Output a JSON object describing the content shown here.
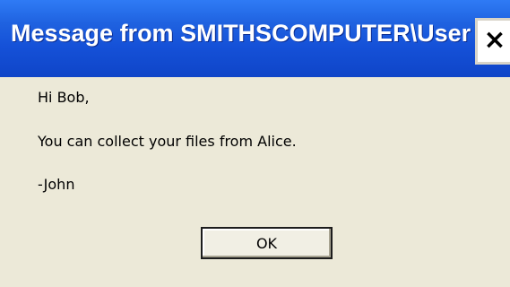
{
  "window": {
    "title": "Message from SMITHSCOMPUTER\\User A",
    "close_glyph": "×",
    "close_icon": "close-icon"
  },
  "message": {
    "lines": [
      "Hi Bob,",
      "You can collect your files from Alice.",
      "-John"
    ]
  },
  "buttons": {
    "ok_label": "OK"
  },
  "colors": {
    "titlebar": "#1f5fe0",
    "dialog_background": "#ece9d8"
  }
}
